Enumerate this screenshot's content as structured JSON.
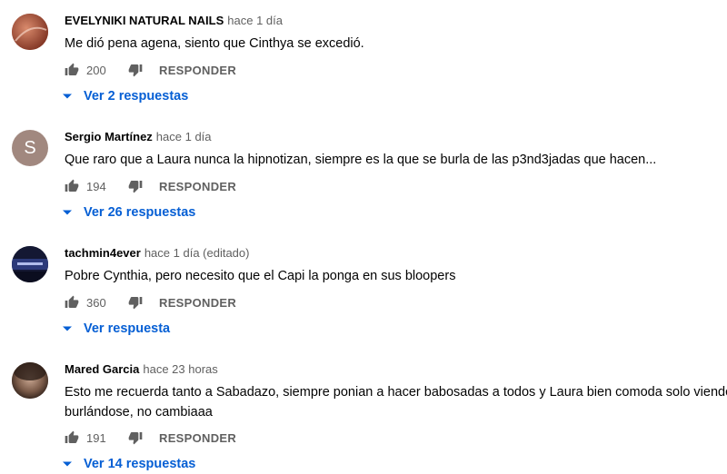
{
  "comments": [
    {
      "author": "EVELYNIKI NATURAL NAILS",
      "meta": "hace 1 día",
      "text": [
        "Me dió pena agena, siento que Cinthya se excedió."
      ],
      "likes": "200",
      "reply_label": "RESPONDER",
      "replies_label": "Ver 2 respuestas",
      "avatar_color": "#b5553a"
    },
    {
      "author": "Sergio Martínez",
      "meta": "hace 1 día",
      "text": [
        "Que raro que a Laura nunca la hipnotizan, siempre es la que se burla de las p3nd3jadas que hacen..."
      ],
      "likes": "194",
      "reply_label": "RESPONDER",
      "replies_label": "Ver 26 respuestas",
      "avatar_letter": "S",
      "avatar_color": "#a1887f"
    },
    {
      "author": "tachmin4ever",
      "meta": "hace 1 día (editado)",
      "text": [
        "Pobre Cynthia, pero necesito que el Capi la ponga en sus bloopers"
      ],
      "likes": "360",
      "reply_label": "RESPONDER",
      "replies_label": "Ver respuesta",
      "avatar_color": "#1b1f3a"
    },
    {
      "author": "Mared Garcia",
      "meta": "hace 23 horas",
      "text": [
        "Esto me recuerda tanto a Sabadazo, siempre ponian a hacer babosadas a todos y Laura bien comoda solo viendo y",
        "burlándose, no cambiaaa"
      ],
      "likes": "191",
      "reply_label": "RESPONDER",
      "replies_label": "Ver 14 respuestas",
      "avatar_color": "#6d5648"
    }
  ],
  "colors": {
    "link": "#065fd4",
    "secondary": "#606060",
    "text": "#030303"
  },
  "icons": {
    "like": "thumb-up-icon",
    "dislike": "thumb-down-icon",
    "expand": "chevron-down-icon"
  }
}
